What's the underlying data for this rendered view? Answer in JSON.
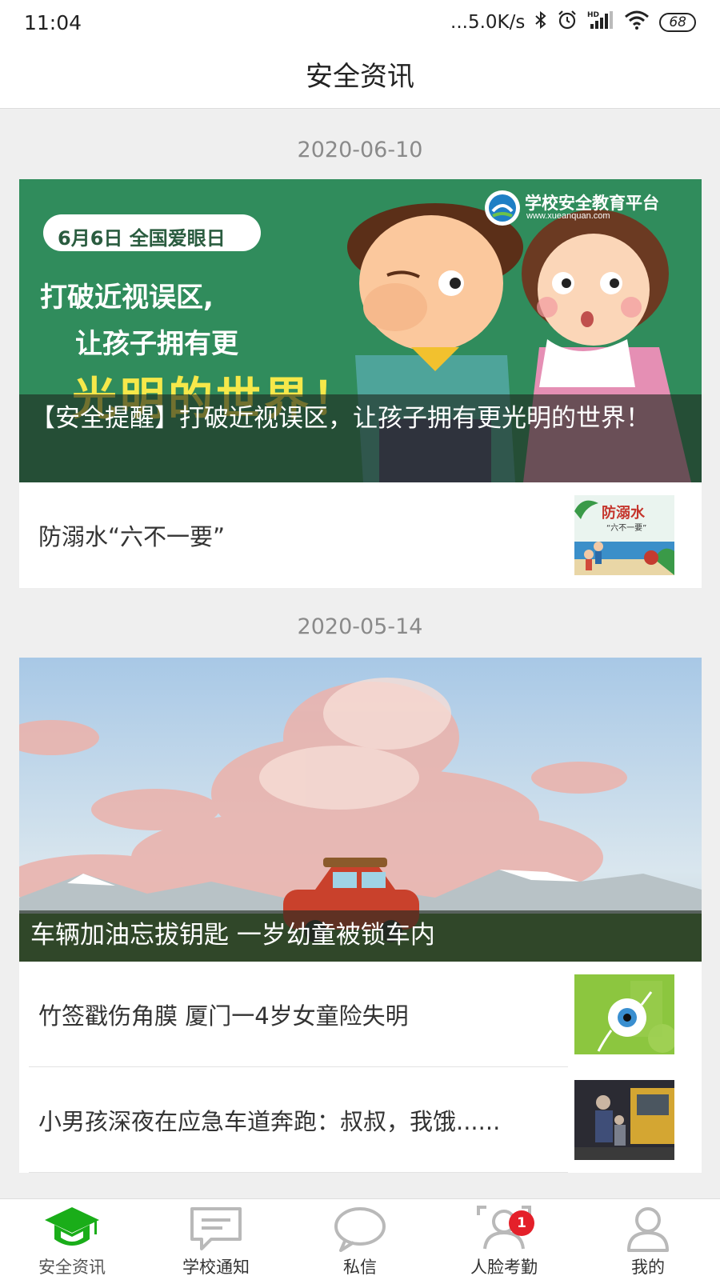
{
  "status": {
    "time": "11:04",
    "speed": "...5.0K/s",
    "battery": "68",
    "network": "HD"
  },
  "header": {
    "title": "安全资讯"
  },
  "groups": [
    {
      "date": "2020-06-10",
      "featured": {
        "title": "【安全提醒】打破近视误区，让孩子拥有更光明的世界！",
        "banner_tag": "6月6日  全国爱眼日",
        "banner_line1": "打破近视误区,",
        "banner_line2": "让孩子拥有更",
        "banner_big": "光明的世界！",
        "logo_text": "学校安全教育平台",
        "logo_url": "www.xueanquan.com"
      },
      "items": [
        {
          "title": "防溺水“六不一要”",
          "thumb_title": "防溺水",
          "thumb_sub": "“六不一要”"
        }
      ]
    },
    {
      "date": "2020-05-14",
      "featured": {
        "title": "车辆加油忘拔钥匙 一岁幼童被锁车内"
      },
      "items": [
        {
          "title": "竹签戳伤角膜 厦门一4岁女童险失明"
        },
        {
          "title": "小男孩深夜在应急车道奔跑：叔叔，我饿......"
        }
      ]
    }
  ],
  "tabs": [
    {
      "label": "安全资讯",
      "icon": "graduation-cap-icon",
      "active": true
    },
    {
      "label": "学校通知",
      "icon": "message-box-icon"
    },
    {
      "label": "私信",
      "icon": "chat-bubble-icon"
    },
    {
      "label": "人脸考勤",
      "icon": "face-attendance-icon",
      "badge": "1"
    },
    {
      "label": "我的",
      "icon": "user-icon"
    }
  ],
  "colors": {
    "accent": "#1aad19",
    "banner_green": "#2d8a5a",
    "badge": "#e4202a"
  }
}
